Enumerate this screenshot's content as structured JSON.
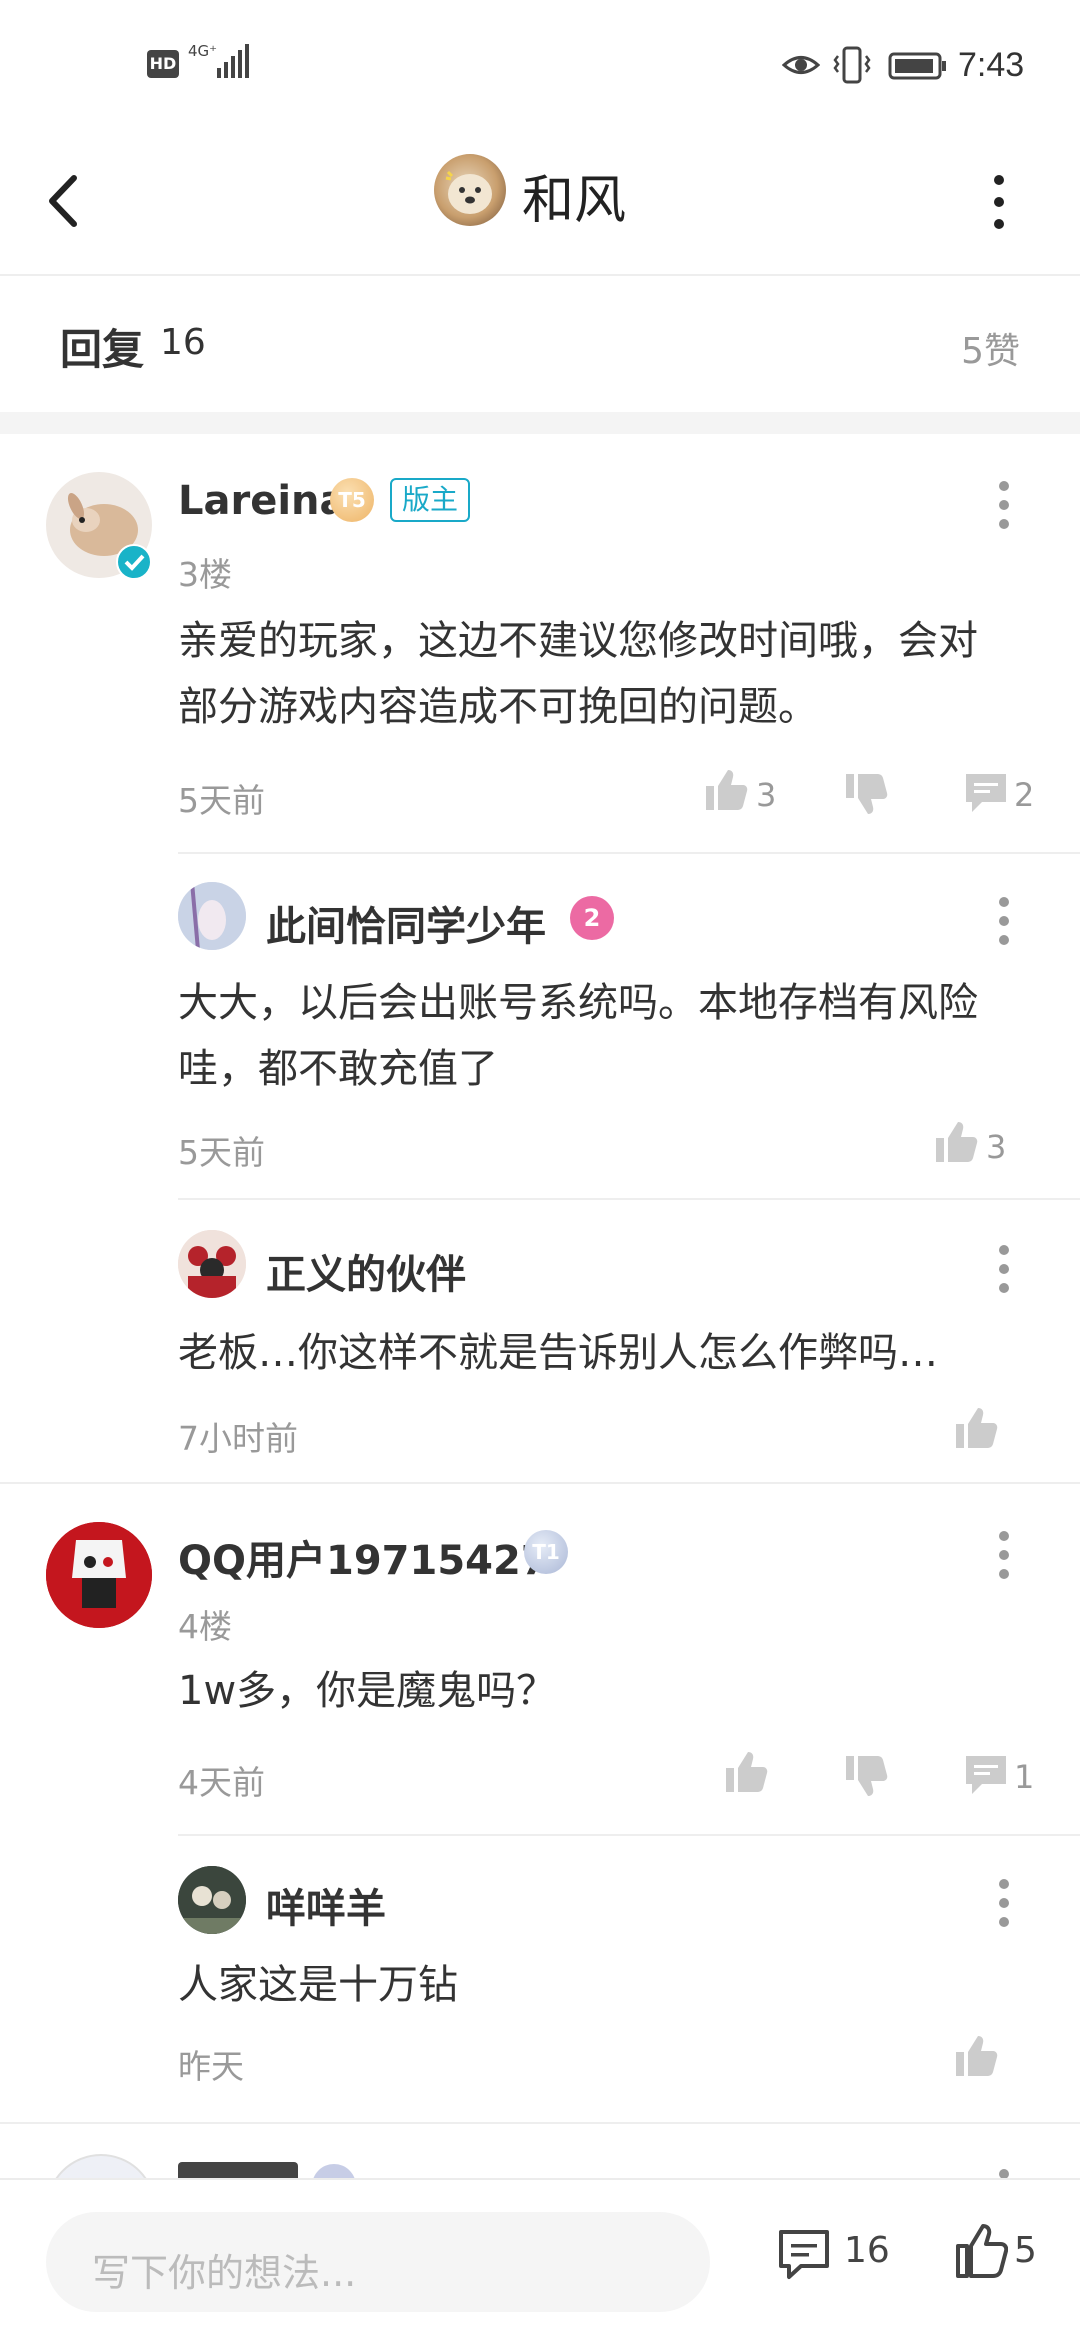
{
  "status_bar": {
    "time": "7:43",
    "hd": "HD",
    "network": "4G⁺"
  },
  "nav": {
    "title": "和风",
    "avatar_icon": "dog-avatar",
    "back_icon": "chevron-left-icon",
    "more_icon": "more-vertical-icon"
  },
  "reply_header": {
    "label": "回复",
    "count": "16",
    "likes": "5赞"
  },
  "comments": [
    {
      "user": "Lareina",
      "level_badge": "T5",
      "role_tag": "版主",
      "floor": "3楼",
      "text_line1": "亲爱的玩家，这边不建议您修改时间哦，会对",
      "text_line2": "部分游戏内容造成不可挽回的问题。",
      "time": "5天前",
      "likes": "3",
      "replies": "2",
      "sub_replies": [
        {
          "user": "此间恰同学少年",
          "level_badge": "2",
          "text_line1": "大大，以后会出账号系统吗。本地存档有风险",
          "text_line2": "哇，都不敢充值了",
          "time": "5天前",
          "likes": "3"
        },
        {
          "user": "正义的伙伴",
          "text_line1": "老板…你这样不就是告诉别人怎么作弊吗…",
          "time": "7小时前"
        }
      ]
    },
    {
      "user": "QQ用户19715427",
      "level_badge": "T1",
      "floor": "4楼",
      "text_line1": "1w多，你是魔鬼吗？",
      "time": "4天前",
      "replies": "1",
      "sub_replies": [
        {
          "user": "咩咩羊",
          "text_line1": "人家这是十万钻",
          "time": "昨天"
        }
      ]
    }
  ],
  "bottom_bar": {
    "placeholder": "写下你的想法...",
    "comment_count": "16",
    "like_count": "5"
  },
  "colors": {
    "mod_tag": "#19a9c8",
    "gold_badge": "#f2c27a",
    "pink_badge": "#ec6aa3",
    "silver_badge": "#aab7d6",
    "verified": "#19b3c8"
  }
}
